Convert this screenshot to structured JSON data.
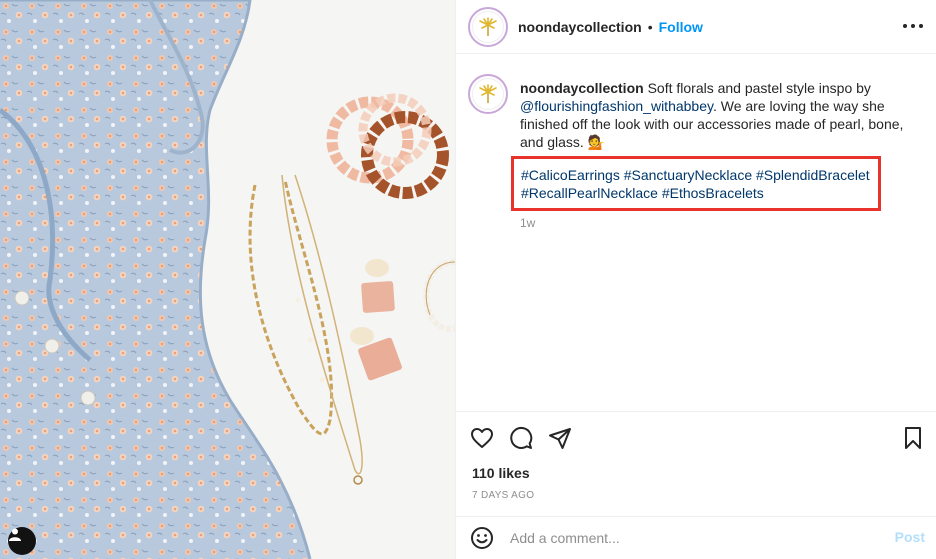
{
  "post": {
    "username": "noondaycollection",
    "follow_label": "Follow",
    "separator": "•",
    "caption": {
      "username": "noondaycollection",
      "text_before": " Soft florals and pastel style inspo by ",
      "mention": "@flourishingfashion_withabbey",
      "text_after": ". We are loving the way she finished off the look with our accessories made of pearl, bone, and glass. 💁",
      "hashtags": [
        "#CalicoEarrings",
        "#SanctuaryNecklace",
        "#SplendidBracelet",
        "#RecallPearlNecklace",
        "#EthosBracelets"
      ],
      "time": "1w"
    },
    "likes": "110 likes",
    "posted_ago": "7 DAYS AGO",
    "comment_placeholder": "Add a comment...",
    "post_label": "Post"
  },
  "colors": {
    "link": "#0095f6",
    "hashtag": "#00376b",
    "highlight_border": "#e8332c",
    "post_disabled": "#b2dffc"
  },
  "icons": {
    "more": "more-options-icon",
    "like": "heart-icon",
    "comment": "comment-icon",
    "share": "share-icon",
    "save": "bookmark-icon",
    "emoji": "emoji-icon",
    "tags": "user-tag-icon"
  }
}
